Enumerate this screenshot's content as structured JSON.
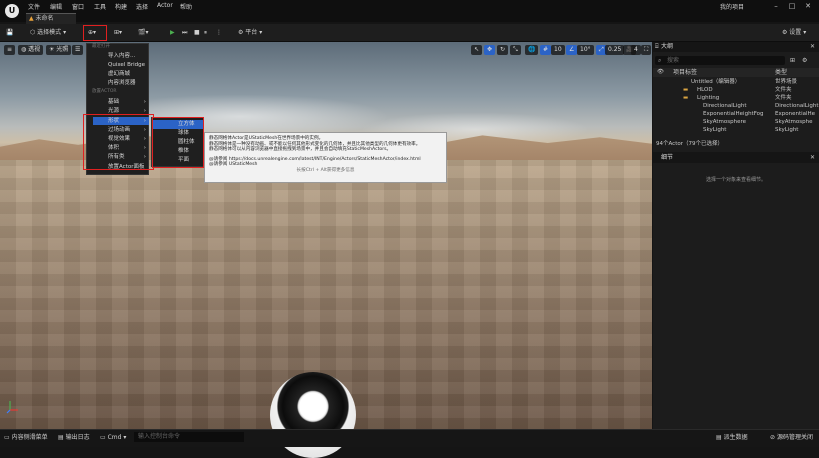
{
  "titlebar": {
    "logo": "U",
    "menus": [
      "文件",
      "编辑",
      "窗口",
      "工具",
      "构建",
      "选择",
      "Actor",
      "帮助"
    ],
    "project_name": "我的项目",
    "tab_label": "未命名"
  },
  "toolbar": {
    "mode_label": "选择模式",
    "platform_label": "平台",
    "settings_label": "设置"
  },
  "viewport": {
    "perspective_label": "透视",
    "lit_label": "光照",
    "grid_value": "10",
    "angle_value": "10°",
    "scale_value": "0.25",
    "camera_speed": "4"
  },
  "add_menu": {
    "section_recent": "最近打开",
    "items_top": [
      "导入内容...",
      "Quixel Bridge",
      "虚幻商城",
      "内容浏览器"
    ],
    "section_place": "放置ACTOR",
    "items_categories": [
      "基础",
      "光源",
      "形状",
      "过场动画",
      "视觉效果",
      "体积",
      "所有类",
      "放置Actor面板"
    ]
  },
  "shapes_submenu": {
    "items": [
      "立方体",
      "球体",
      "圆柱体",
      "椎体",
      "平面"
    ]
  },
  "tooltip": {
    "lines": [
      "静态网格体Actor是UStaticMesh在世界场景中的实例。",
      "静态网格体是一种没有动画、或不能以任何其他形式变化的几何体，并且比其他类型的几何体更有效率。",
      "静态网格体可以从内容浏览器中直接拖拽到场景中，并且会自动填充StaticMeshActors。",
      "",
      "@请参阅 https://docs.unrealengine.com/latest/INT/Engine/Actors/StaticMeshActor/index.html",
      "@请参阅 UStaticMesh"
    ],
    "hint": "长按Ctrl + Alt获得更多信息"
  },
  "outliner": {
    "title": "大纲",
    "search_placeholder": "搜索",
    "col_label": "项目标签",
    "col_type": "类型",
    "rows": [
      {
        "label": "Untitled（编辑器）",
        "type": "世界场景"
      },
      {
        "label": "HLOD",
        "type": "文件夹"
      },
      {
        "label": "Lighting",
        "type": "文件夹"
      },
      {
        "label": "DirectionalLight",
        "type": "DirectionalLight"
      },
      {
        "label": "ExponentialHeightFog",
        "type": "ExponentialHe"
      },
      {
        "label": "SkyAtmosphere",
        "type": "SkyAtmosphe"
      },
      {
        "label": "SkyLight",
        "type": "SkyLight"
      }
    ],
    "count_label": "94个Actor（79个已选择）"
  },
  "details": {
    "title": "细节",
    "empty_text": "选择一个对象来查看细节。"
  },
  "bottombar": {
    "content_drawer": "内容侧滑菜单",
    "output_log": "输出日志",
    "cmd_label": "Cmd",
    "console_placeholder": "输入控制台命令",
    "derived_data": "派生数据",
    "source_control": "源码管理关闭"
  }
}
